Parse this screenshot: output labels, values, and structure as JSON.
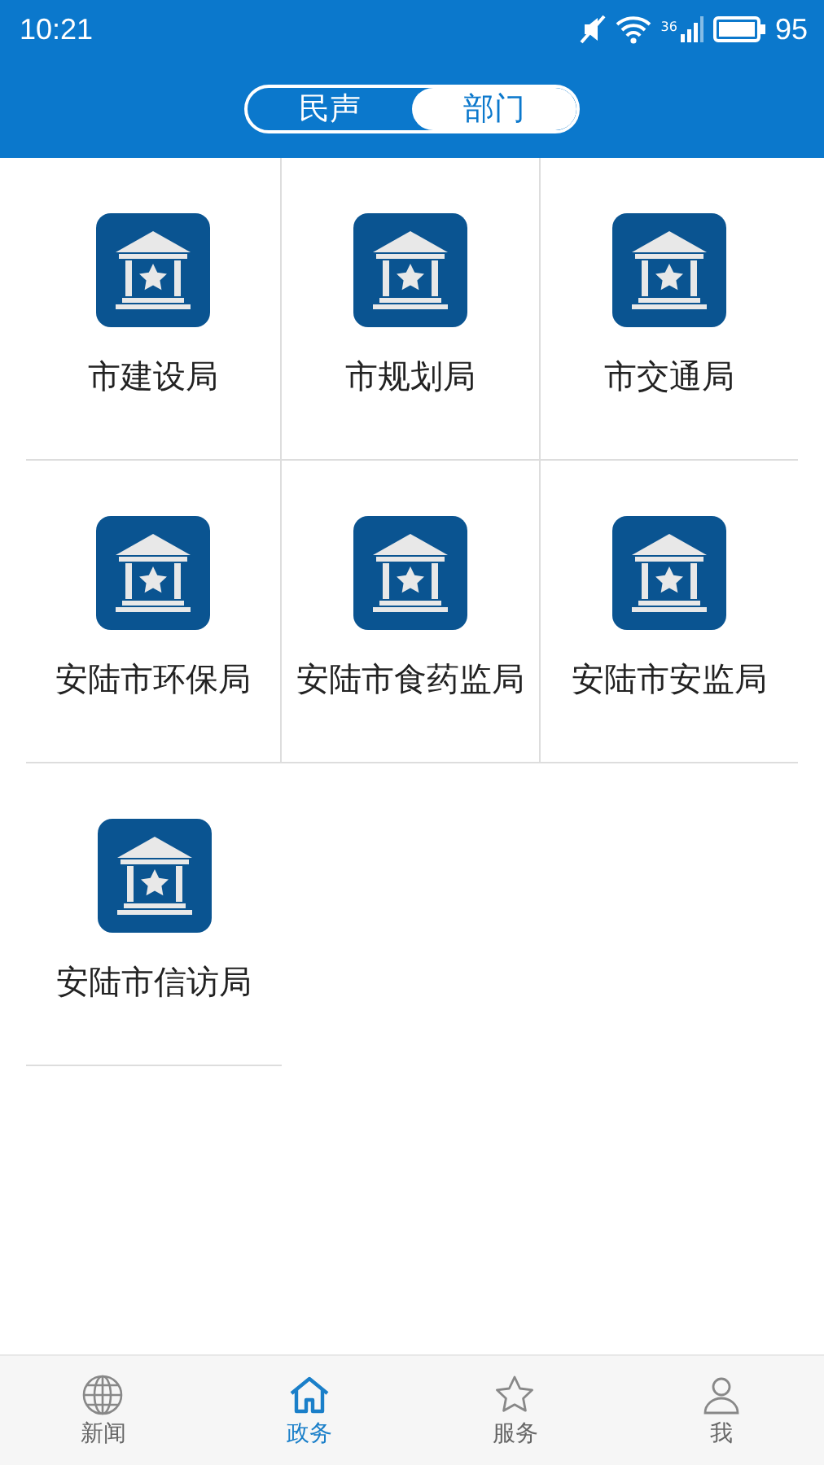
{
  "status_bar": {
    "time": "10:21",
    "battery": "95",
    "network": "36"
  },
  "segmented": [
    {
      "label": "民声",
      "selected": false
    },
    {
      "label": "部门",
      "selected": true
    }
  ],
  "departments": [
    {
      "name": "市建设局"
    },
    {
      "name": "市规划局"
    },
    {
      "name": "市交通局"
    },
    {
      "name": "安陆市环保局"
    },
    {
      "name": "安陆市食药监局"
    },
    {
      "name": "安陆市安监局"
    },
    {
      "name": "安陆市信访局"
    }
  ],
  "bottom_nav": [
    {
      "label": "新闻",
      "kind": "globe",
      "selected": false
    },
    {
      "label": "政务",
      "kind": "home",
      "selected": true
    },
    {
      "label": "服务",
      "kind": "star",
      "selected": false
    },
    {
      "label": "我",
      "kind": "person",
      "selected": false
    }
  ]
}
